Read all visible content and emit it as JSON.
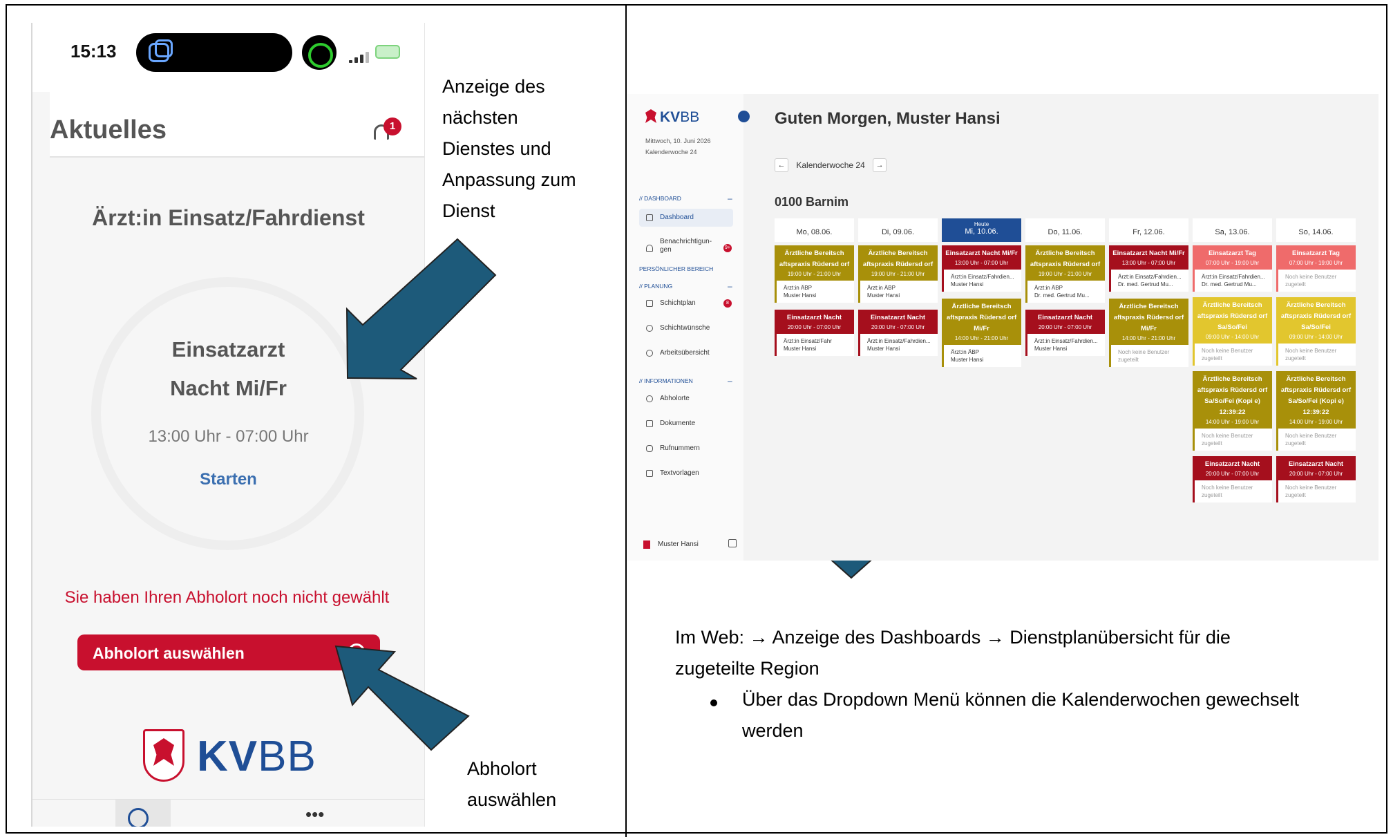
{
  "phone": {
    "time": "15:13",
    "title": "Aktuelles",
    "notification_count": "1",
    "role": "Ärzt:in Einsatz/Fahrdienst",
    "shift_line1": "Einsatzarzt",
    "shift_line2": "Nacht Mi/Fr",
    "hours": "13:00 Uhr - 07:00 Uhr",
    "start_label": "Starten",
    "warning": "Sie haben Ihren Abholort noch nicht gewählt",
    "pick_button": "Abholort auswählen",
    "logo_bold": "KV",
    "logo_light": "BB",
    "more": "•••"
  },
  "annotations": {
    "top": [
      "Anzeige des",
      "nächsten",
      "Dienstes und",
      "Anpassung zum",
      "Dienst"
    ],
    "bottom": [
      "Abholort",
      "auswählen"
    ],
    "web_line1": "Im Web: → Anzeige des Dashboards → Dienstplanübersicht für die",
    "web_line2": "zugeteilte Region",
    "bullet_line1": "Über das Dropdown Menü können die Kalenderwochen gewechselt",
    "bullet_line2": "werden"
  },
  "web": {
    "brand_bold": "KV",
    "brand_light": "BB",
    "date_line1": "Mittwoch, 10. Juni 2026",
    "date_line2": "Kalenderwoche 24",
    "greeting": "Guten Morgen, Muster Hansi",
    "week_label": "Kalenderwoche 24",
    "prev": "←",
    "next": "→",
    "region": "0100 Barnim",
    "sections": {
      "dashboard": "// DASHBOARD",
      "personal": "PERSÖNLICHER BEREICH",
      "planning": "// PLANUNG",
      "info": "// INFORMATIONEN",
      "minus": "–"
    },
    "nav": {
      "dashboard": "Dashboard",
      "notifications": "Benachrichtigun-\ngen",
      "notifications_count": "9+",
      "schedule": "Schichtplan",
      "schedule_count": "8",
      "wishes": "Schichtwünsche",
      "overview": "Arbeitsübersicht",
      "pickup": "Abholorte",
      "documents": "Dokumente",
      "phones": "Rufnummern",
      "templates": "Textvorlagen"
    },
    "user": "Muster Hansi",
    "today_label": "Heute",
    "days": [
      {
        "label": "Mo, 08.06."
      },
      {
        "label": "Di, 09.06."
      },
      {
        "label": "Mi, 10.06."
      },
      {
        "label": "Do, 11.06."
      },
      {
        "label": "Fr, 12.06."
      },
      {
        "label": "Sa, 13.06."
      },
      {
        "label": "So, 14.06."
      }
    ],
    "cards": {
      "aerztl": "Ärztliche Bereitsch aftspraxis Rüdersd orf",
      "aerztl_mifr": "Ärztliche Bereitsch aftspraxis Rüdersd orf Mi/Fr",
      "aerztl_sa": "Ärztliche Bereitsch aftspraxis Rüdersd orf Sa/So/Fei",
      "aerztl_kopie": "Ärztliche Bereitsch aftspraxis Rüdersd orf Sa/So/Fei (Kopi e) 12:39:22",
      "nacht": "Einsatzarzt Nacht",
      "nacht_mifr": "Einsatzarzt Nacht Mi/Fr",
      "tag": "Einsatzarzt Tag",
      "t_19_21": "19:00 Uhr - 21:00 Uhr",
      "t_20_07": "20:00 Uhr - 07:00 Uhr",
      "t_13_07": "13:00 Uhr - 07:00 Uhr",
      "t_14_21": "14:00 Uhr - 21:00 Uhr",
      "t_07_19": "07:00 Uhr - 19:00 Uhr",
      "t_09_14": "09:00 Uhr - 14:00 Uhr",
      "t_14_19": "14:00 Uhr - 19:00 Uhr",
      "role_abp": "Ärzt:in ÄBP",
      "role_fahr": "Ärzt:in Einsatz/Fahrdien...",
      "role_fahr_short": "Ärzt:in Einsatz/Fahr",
      "muster": "Muster Hansi",
      "gertrud": "Dr. med. Gertrud Mu...",
      "none": "Noch keine Benutzer zugeteilt"
    }
  }
}
